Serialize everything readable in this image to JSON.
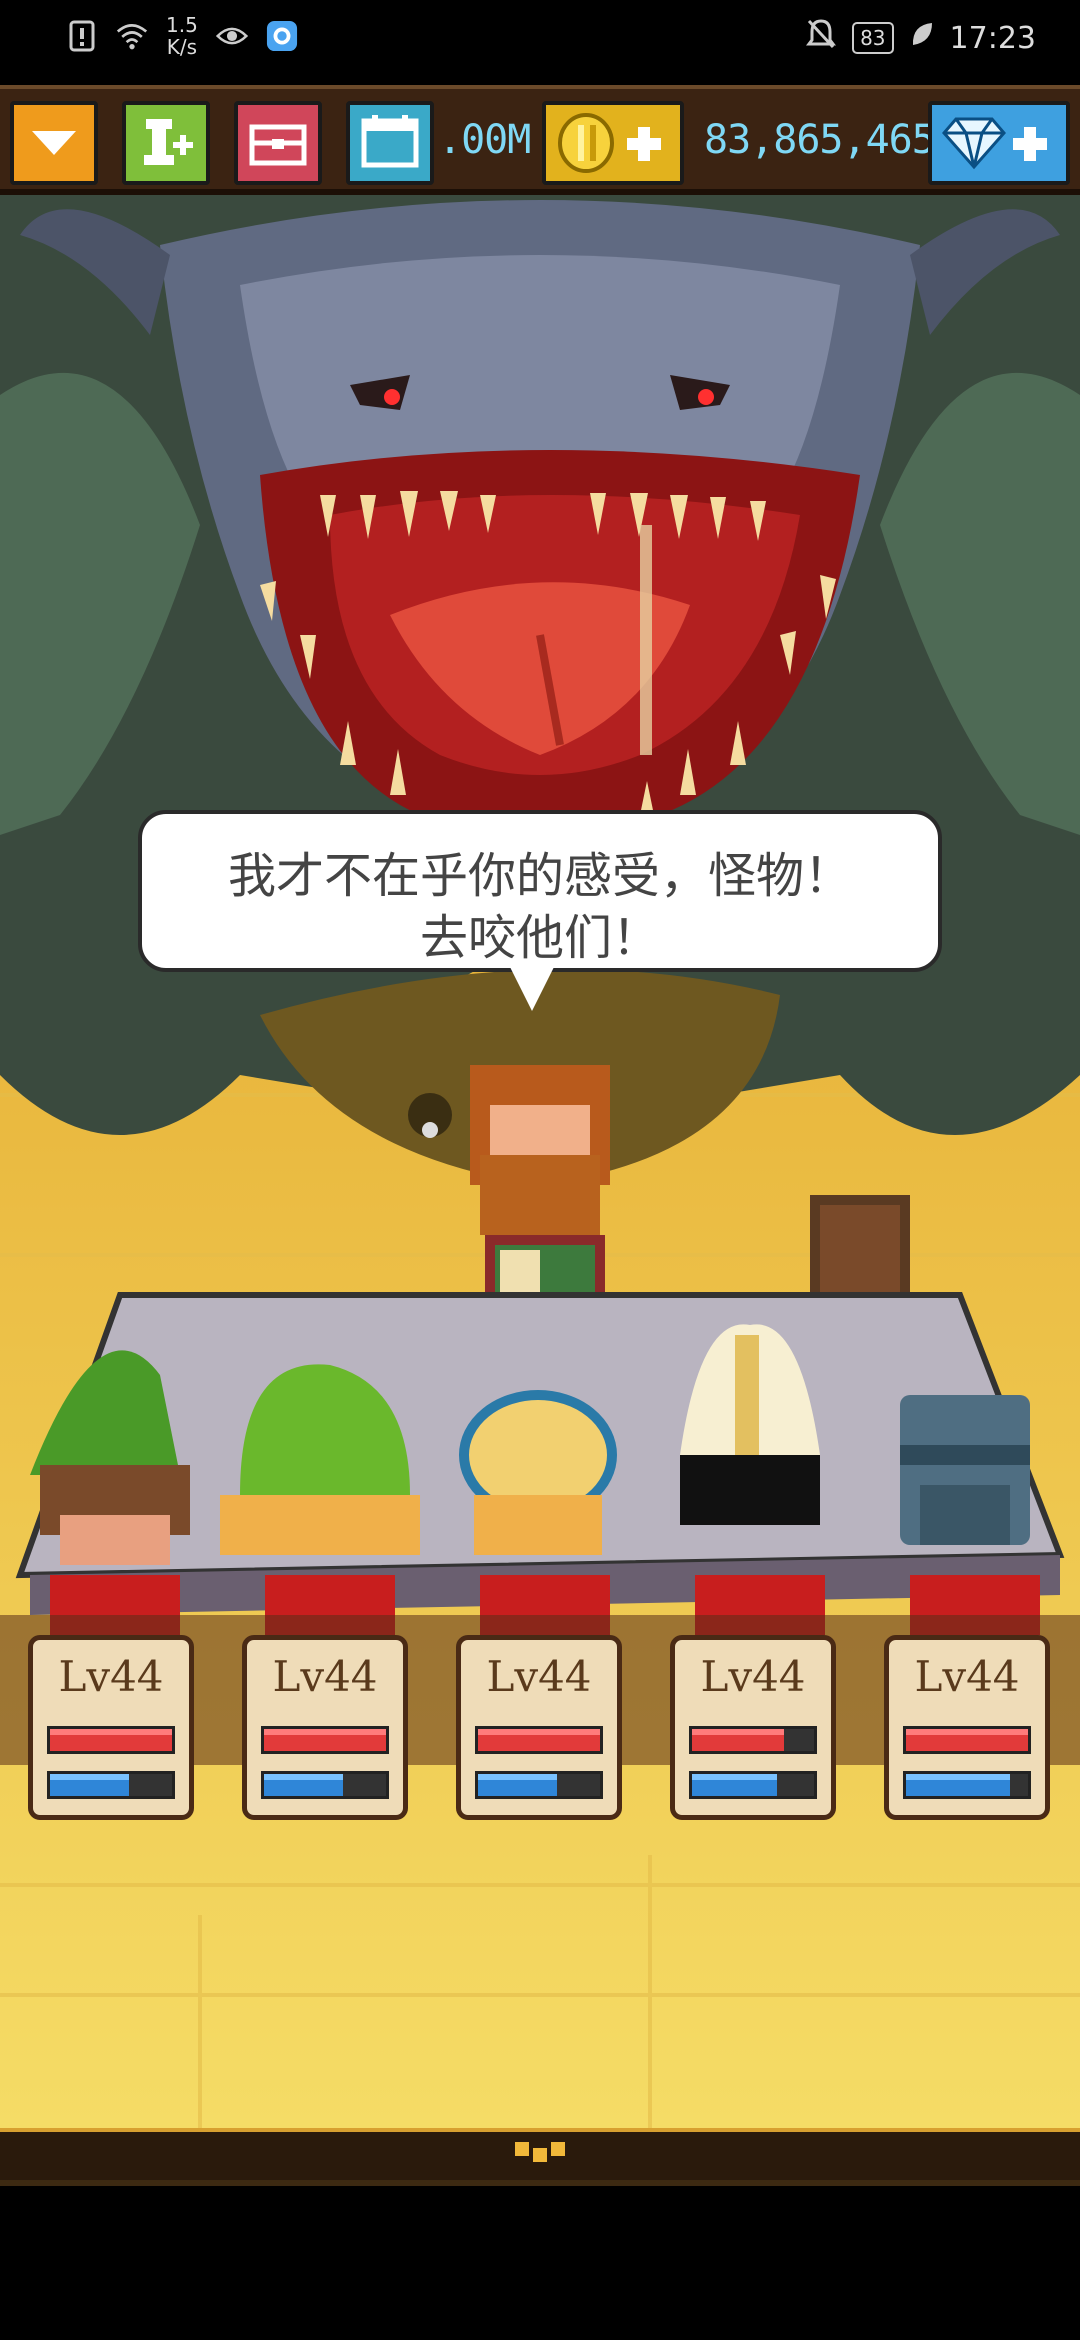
{
  "status_bar": {
    "net_speed_value": "1.5",
    "net_speed_unit": "K/s",
    "battery": "83",
    "time": "17:23"
  },
  "toolbar": {
    "calendar_value": ".00M",
    "gold_value": "83,865,465",
    "icons": [
      "dropdown-icon",
      "recruit-icon",
      "chest-icon",
      "calendar-icon",
      "gold-coin-icon",
      "diamond-icon"
    ],
    "colors": {
      "menu": "#ef9b1c",
      "recruit": "#7fbf3a",
      "chest": "#d0465a",
      "calendar": "#3aa9c8",
      "gold": "#e2b21d",
      "gems": "#3ea0e0"
    }
  },
  "dialog": {
    "line1": "我才不在乎你的感受，怪物！",
    "line2": "去咬他们！"
  },
  "party": [
    {
      "level": "Lv44",
      "hp": 1.0,
      "mp": 0.65
    },
    {
      "level": "Lv44",
      "hp": 1.0,
      "mp": 0.65
    },
    {
      "level": "Lv44",
      "hp": 1.0,
      "mp": 0.65
    },
    {
      "level": "Lv44",
      "hp": 0.75,
      "mp": 0.7
    },
    {
      "level": "Lv44",
      "hp": 1.0,
      "mp": 0.85
    }
  ]
}
